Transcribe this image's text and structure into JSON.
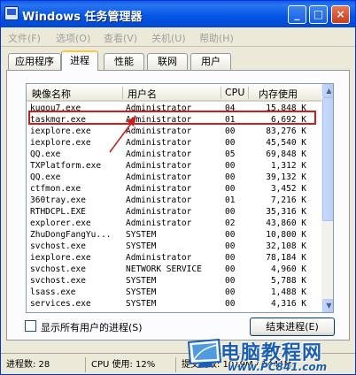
{
  "window": {
    "title": "Windows 任务管理器",
    "buttons": {
      "minimize": "_",
      "maximize": "□",
      "close": "×"
    }
  },
  "menu": [
    {
      "label": "文件(F)"
    },
    {
      "label": "选项(O)"
    },
    {
      "label": "查看(V)"
    },
    {
      "label": "关机(U)"
    },
    {
      "label": "帮助(H)"
    }
  ],
  "tabs": [
    {
      "label": "应用程序",
      "active": false
    },
    {
      "label": "进程",
      "active": true
    },
    {
      "label": "性能",
      "active": false
    },
    {
      "label": "联网",
      "active": false
    },
    {
      "label": "用户",
      "active": false
    }
  ],
  "columns": {
    "image": "映像名称",
    "user": "用户名",
    "cpu": "CPU",
    "mem": "内存使用"
  },
  "processes": [
    {
      "name": "kugou7.exe",
      "user": "Administrator",
      "cpu": "04",
      "mem": "15,848 K"
    },
    {
      "name": "taskmgr.exe",
      "user": "Administrator",
      "cpu": "01",
      "mem": "6,692 K"
    },
    {
      "name": "iexplore.exe",
      "user": "Administrator",
      "cpu": "00",
      "mem": "83,276 K"
    },
    {
      "name": "iexplore.exe",
      "user": "Administrator",
      "cpu": "00",
      "mem": "45,540 K"
    },
    {
      "name": "QQ.exe",
      "user": "Administrator",
      "cpu": "05",
      "mem": "69,848 K"
    },
    {
      "name": "TXPlatform.exe",
      "user": "Administrator",
      "cpu": "00",
      "mem": "1,312 K"
    },
    {
      "name": "QQ.exe",
      "user": "Administrator",
      "cpu": "00",
      "mem": "39,132 K"
    },
    {
      "name": "ctfmon.exe",
      "user": "Administrator",
      "cpu": "00",
      "mem": "3,452 K"
    },
    {
      "name": "360tray.exe",
      "user": "Administrator",
      "cpu": "01",
      "mem": "7,216 K"
    },
    {
      "name": "RTHDCPL.EXE",
      "user": "Administrator",
      "cpu": "00",
      "mem": "35,316 K"
    },
    {
      "name": "explorer.exe",
      "user": "Administrator",
      "cpu": "02",
      "mem": "43,860 K"
    },
    {
      "name": "ZhuDongFangYu...",
      "user": "SYSTEM",
      "cpu": "00",
      "mem": "10,800 K"
    },
    {
      "name": "svchost.exe",
      "user": "SYSTEM",
      "cpu": "00",
      "mem": "32,108 K"
    },
    {
      "name": "iexplore.exe",
      "user": "Administrator",
      "cpu": "00",
      "mem": "78,184 K"
    },
    {
      "name": "svchost.exe",
      "user": "NETWORK SERVICE",
      "cpu": "00",
      "mem": "4,960 K"
    },
    {
      "name": "svchost.exe",
      "user": "SYSTEM",
      "cpu": "00",
      "mem": "5,788 K"
    },
    {
      "name": "lsass.exe",
      "user": "SYSTEM",
      "cpu": "00",
      "mem": "1,488 K"
    },
    {
      "name": "services.exe",
      "user": "SYSTEM",
      "cpu": "00",
      "mem": "4,316 K"
    }
  ],
  "show_all_users": {
    "label": "显示所有用户的进程(S)",
    "checked": false
  },
  "end_process": {
    "label": "结束进程(E)"
  },
  "status": {
    "process_count": "进程数: 28",
    "cpu_usage": "CPU 使用: 12%",
    "commit": "提交更改: 1019M / 1441M"
  },
  "watermark": {
    "title": "电脑教程网",
    "url": "www.PC841.com"
  },
  "colors": {
    "titlebar": "#0055e5",
    "highlight": "#c9201c",
    "watermark": "#1b5fb4"
  }
}
